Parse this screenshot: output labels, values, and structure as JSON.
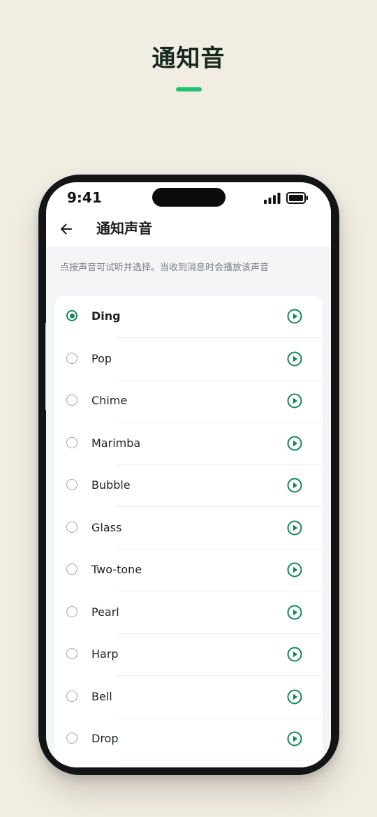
{
  "page": {
    "heading": "通知音"
  },
  "status_bar": {
    "time": "9:41"
  },
  "app_bar": {
    "back_icon": "arrow-left-icon",
    "title": "通知声音"
  },
  "hint": "点按声音可试听并选择。当收到消息时会播放该声音",
  "sounds": [
    {
      "label": "Ding",
      "selected": true
    },
    {
      "label": "Pop",
      "selected": false
    },
    {
      "label": "Chime",
      "selected": false
    },
    {
      "label": "Marimba",
      "selected": false
    },
    {
      "label": "Bubble",
      "selected": false
    },
    {
      "label": "Glass",
      "selected": false
    },
    {
      "label": "Two-tone",
      "selected": false
    },
    {
      "label": "Pearl",
      "selected": false
    },
    {
      "label": "Harp",
      "selected": false
    },
    {
      "label": "Bell",
      "selected": false
    },
    {
      "label": "Drop",
      "selected": false
    }
  ],
  "colors": {
    "accent": "#15875a",
    "heading_underline": "#1fc171",
    "background": "#f1ede3"
  }
}
